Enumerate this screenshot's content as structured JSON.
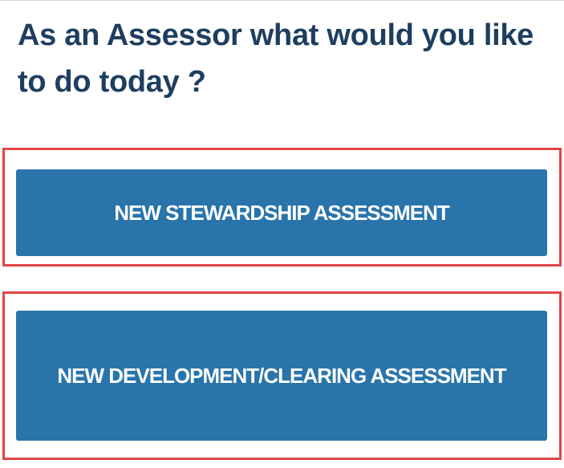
{
  "prompt": {
    "text": "As an Assessor what would you like to do today ?"
  },
  "actions": [
    {
      "label": "NEW STEWARDSHIP ASSESSMENT"
    },
    {
      "label": "NEW DEVELOPMENT/CLEARING ASSESSMENT"
    }
  ],
  "colors": {
    "heading": "#1f3e5f",
    "button_bg": "#2874ab",
    "button_text": "#ffffff",
    "highlight": "#e04646"
  }
}
